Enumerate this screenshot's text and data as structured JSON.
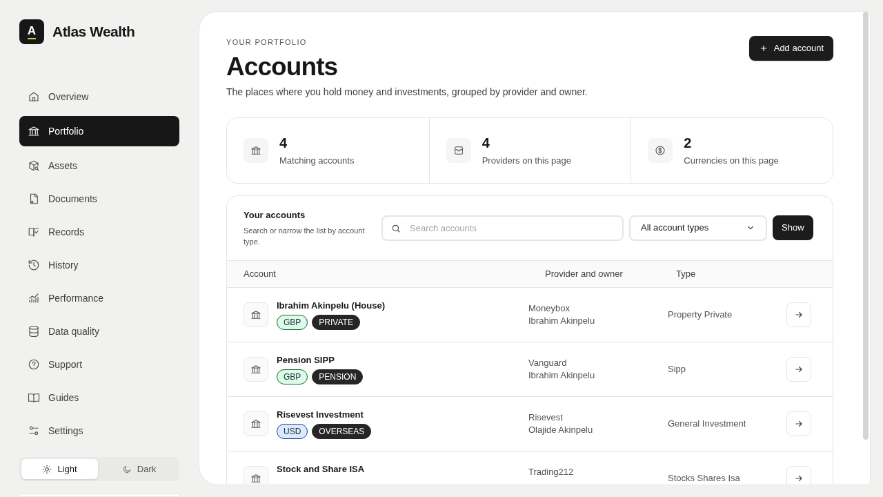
{
  "brand": {
    "logo_letter": "A",
    "name": "Atlas Wealth"
  },
  "nav": [
    {
      "label": "Overview",
      "selected": false
    },
    {
      "label": "Portfolio",
      "selected": true
    },
    {
      "label": "Assets",
      "selected": false
    },
    {
      "label": "Documents",
      "selected": false
    },
    {
      "label": "Records",
      "selected": false
    },
    {
      "label": "History",
      "selected": false
    },
    {
      "label": "Performance",
      "selected": false
    },
    {
      "label": "Data quality",
      "selected": false
    },
    {
      "label": "Support",
      "selected": false
    },
    {
      "label": "Guides",
      "selected": false
    },
    {
      "label": "Settings",
      "selected": false
    }
  ],
  "theme_toggle": [
    {
      "label": "Light",
      "selected": true
    },
    {
      "label": "Dark",
      "selected": false
    }
  ],
  "header": {
    "eyebrow": "YOUR PORTFOLIO",
    "title": "Accounts",
    "subtitle": "The places where you hold money and investments, grouped by provider and owner.",
    "action": "Add account"
  },
  "stats": [
    {
      "value": "4",
      "label": "Matching accounts"
    },
    {
      "value": "4",
      "label": "Providers on this page"
    },
    {
      "value": "2",
      "label": "Currencies on this page"
    }
  ],
  "accounts": {
    "title": "Your accounts",
    "description": "Search or narrow the list by account type.",
    "search": {
      "placeholder": "Search accounts"
    },
    "filter": {
      "value": "All account types"
    },
    "button": "Show",
    "columns": [
      "Account",
      "Provider and owner",
      "Type"
    ],
    "rows": [
      {
        "name": "Ibrahim Akinpelu (House)",
        "tags": [
          {
            "label": "GBP",
            "color": "#dcfce7"
          },
          {
            "label": "PRIVATE",
            "color": "#262626"
          }
        ],
        "provider": "Moneybox",
        "owner": "Ibrahim Akinpelu",
        "type": "Property Private"
      },
      {
        "name": "Pension SIPP",
        "tags": [
          {
            "label": "GBP",
            "color": "#dcfce7"
          },
          {
            "label": "PENSION",
            "color": "#262626"
          }
        ],
        "provider": "Vanguard",
        "owner": "Ibrahim Akinpelu",
        "type": "Sipp"
      },
      {
        "name": "Risevest Investment",
        "tags": [
          {
            "label": "USD",
            "color": "#dbeafe"
          },
          {
            "label": "OVERSEAS",
            "color": "#262626"
          }
        ],
        "provider": "Risevest",
        "owner": "Olajide Akinpelu",
        "type": "General Investment"
      },
      {
        "name": "Stock and Share ISA",
        "tags": [],
        "provider": "Trading212",
        "type": "Stocks Shares Isa"
      }
    ]
  }
}
